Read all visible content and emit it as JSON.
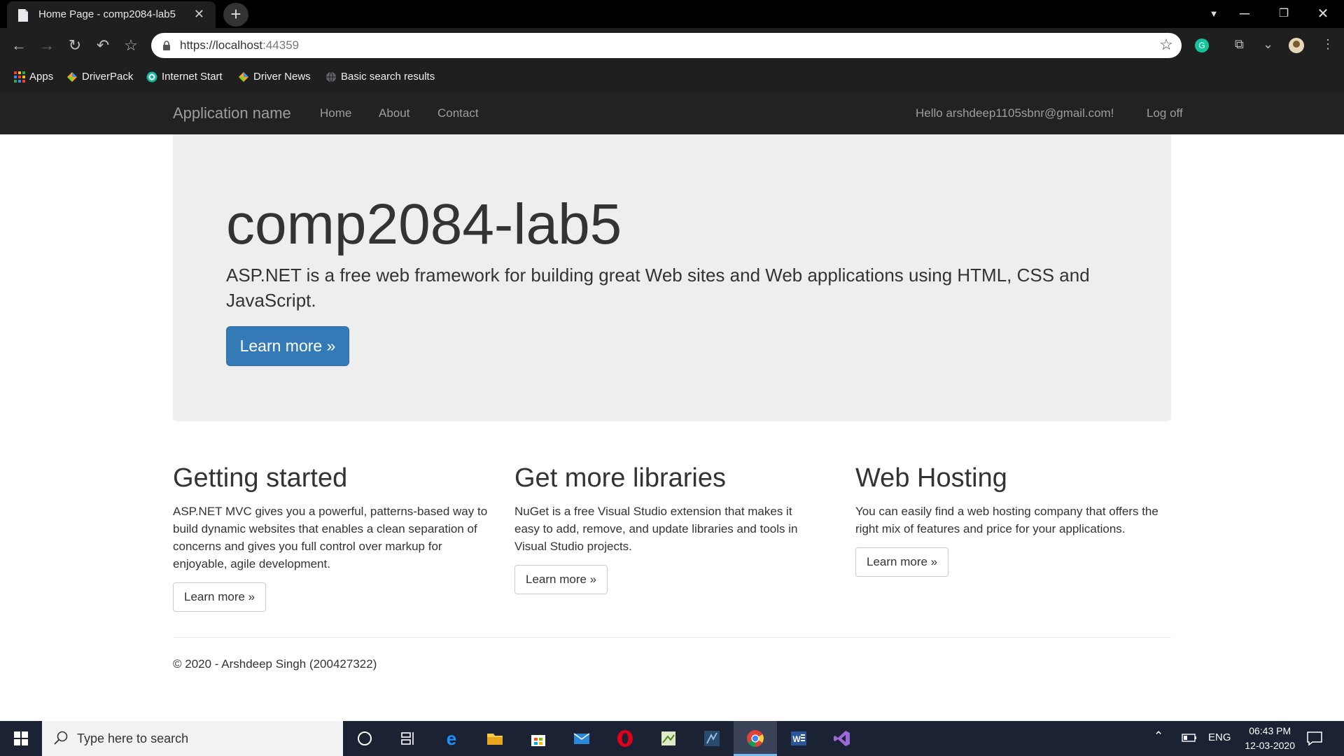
{
  "browser": {
    "tab_title": "Home Page - comp2084-lab5",
    "url_host": "https://localhost",
    "url_port": ":44359",
    "bookmarks": [
      {
        "label": "Apps",
        "icon": "apps-grid-icon"
      },
      {
        "label": "DriverPack",
        "icon": "driverpack-icon"
      },
      {
        "label": "Internet Start",
        "icon": "internet-start-icon"
      },
      {
        "label": "Driver News",
        "icon": "driverpack-icon"
      },
      {
        "label": "Basic search results",
        "icon": "globe-icon"
      }
    ]
  },
  "navbar": {
    "brand": "Application name",
    "links": [
      "Home",
      "About",
      "Contact"
    ],
    "greeting": "Hello arshdeep1105sbnr@gmail.com!",
    "logoff": "Log off"
  },
  "jumbotron": {
    "title": "comp2084-lab5",
    "lead": "ASP.NET is a free web framework for building great Web sites and Web applications using HTML, CSS and JavaScript.",
    "button": "Learn more »"
  },
  "columns": [
    {
      "heading": "Getting started",
      "text": "ASP.NET MVC gives you a powerful, patterns-based way to build dynamic websites that enables a clean separation of concerns and gives you full control over markup for enjoyable, agile development.",
      "button": "Learn more »"
    },
    {
      "heading": "Get more libraries",
      "text": "NuGet is a free Visual Studio extension that makes it easy to add, remove, and update libraries and tools in Visual Studio projects.",
      "button": "Learn more »"
    },
    {
      "heading": "Web Hosting",
      "text": "You can easily find a web hosting company that offers the right mix of features and price for your applications.",
      "button": "Learn more »"
    }
  ],
  "footer": "© 2020 - Arshdeep Singh (200427322)",
  "taskbar": {
    "search_placeholder": "Type here to search",
    "language": "ENG",
    "time": "06:43 PM",
    "date": "12-03-2020"
  },
  "colors": {
    "navbar_bg": "#222222",
    "jumbotron_bg": "#eeeeee",
    "primary": "#337ab7",
    "taskbar_bg": "#1a2233"
  }
}
